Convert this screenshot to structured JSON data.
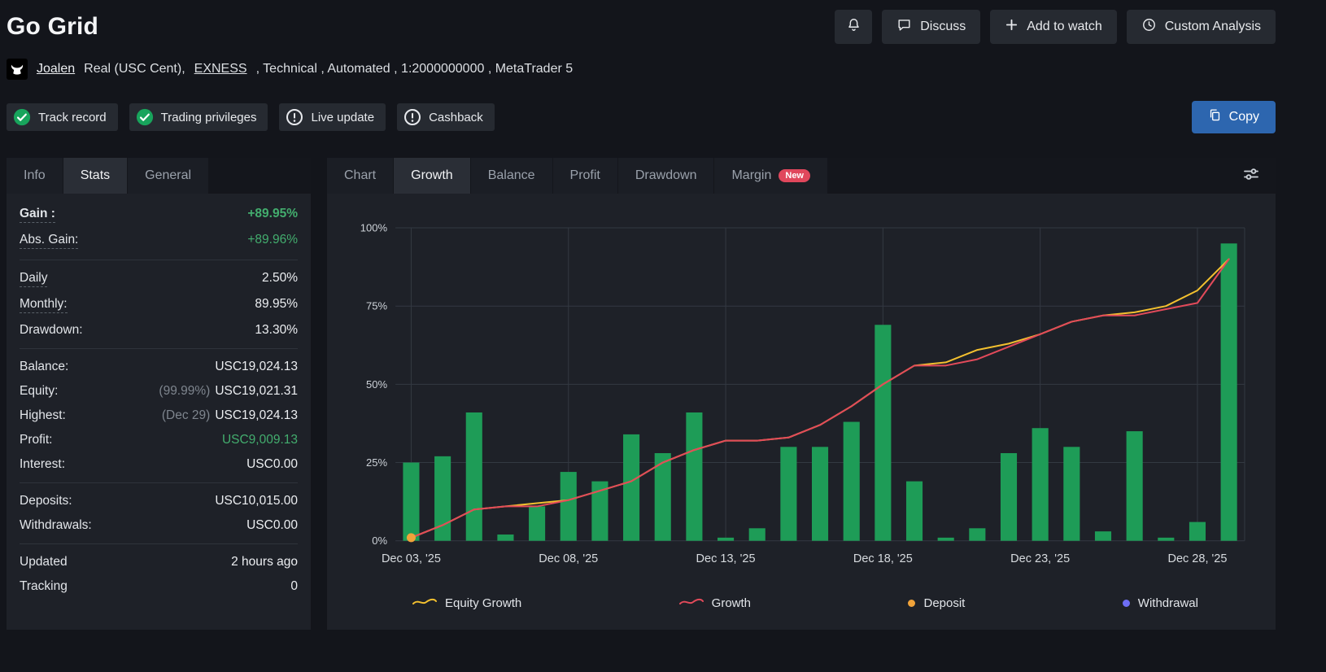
{
  "header": {
    "title": "Go Grid",
    "actions": {
      "discuss": "Discuss",
      "add_to_watch": "Add to watch",
      "custom_analysis": "Custom Analysis"
    }
  },
  "account": {
    "name": "Joalen",
    "type": "Real (USC Cent),",
    "broker": "EXNESS",
    "details": ", Technical , Automated , 1:2000000000 , MetaTrader 5"
  },
  "badges": [
    {
      "label": "Track record",
      "status": "verified"
    },
    {
      "label": "Trading privileges",
      "status": "verified"
    },
    {
      "label": "Live update",
      "status": "warning"
    },
    {
      "label": "Cashback",
      "status": "warning"
    }
  ],
  "copy_button": "Copy",
  "stats_panel": {
    "tabs": [
      {
        "label": "Info",
        "active": false
      },
      {
        "label": "Stats",
        "active": true
      },
      {
        "label": "General",
        "active": false
      }
    ],
    "groups": [
      {
        "rows": [
          {
            "label": "Gain :",
            "value": "+89.95%",
            "value_color": "green",
            "bold": true,
            "underline": true
          },
          {
            "label": "Abs. Gain:",
            "value": "+89.96%",
            "value_color": "green",
            "underline": true
          }
        ]
      },
      {
        "rows": [
          {
            "label": "Daily",
            "value": "2.50%",
            "underline": true
          },
          {
            "label": "Monthly:",
            "value": "89.95%",
            "underline": true
          },
          {
            "label": "Drawdown:",
            "value": "13.30%"
          }
        ]
      },
      {
        "rows": [
          {
            "label": "Balance:",
            "value": "USC19,024.13"
          },
          {
            "label": "Equity:",
            "prefix": "(99.99%)",
            "value": "USC19,021.31"
          },
          {
            "label": "Highest:",
            "prefix": "(Dec 29)",
            "value": "USC19,024.13"
          },
          {
            "label": "Profit:",
            "value": "USC9,009.13",
            "value_color": "green"
          },
          {
            "label": "Interest:",
            "value": "USC0.00"
          }
        ]
      },
      {
        "rows": [
          {
            "label": "Deposits:",
            "value": "USC10,015.00"
          },
          {
            "label": "Withdrawals:",
            "value": "USC0.00"
          }
        ]
      },
      {
        "rows": [
          {
            "label": "Updated",
            "value": "2 hours ago"
          },
          {
            "label": "Tracking",
            "value": "0"
          }
        ]
      }
    ]
  },
  "chart_panel": {
    "tabs": [
      {
        "label": "Chart",
        "active": false
      },
      {
        "label": "Growth",
        "active": true
      },
      {
        "label": "Balance",
        "active": false
      },
      {
        "label": "Profit",
        "active": false
      },
      {
        "label": "Drawdown",
        "active": false
      },
      {
        "label": "Margin",
        "active": false,
        "badge": "New"
      }
    ]
  },
  "chart_data": {
    "type": "bar+line",
    "title": "Growth",
    "categories": [
      "Dec 03",
      "Dec 04",
      "Dec 05",
      "Dec 06",
      "Dec 07",
      "Dec 08",
      "Dec 09",
      "Dec 10",
      "Dec 11",
      "Dec 12",
      "Dec 13",
      "Dec 14",
      "Dec 15",
      "Dec 16",
      "Dec 17",
      "Dec 18",
      "Dec 19",
      "Dec 20",
      "Dec 21",
      "Dec 22",
      "Dec 23",
      "Dec 24",
      "Dec 25",
      "Dec 26",
      "Dec 27",
      "Dec 28",
      "Dec 29"
    ],
    "bar_series": {
      "name": "Daily Gain",
      "color": "#1e9c57",
      "values": [
        25,
        27,
        41,
        2,
        11,
        22,
        19,
        34,
        28,
        41,
        1,
        4,
        30,
        30,
        38,
        69,
        19,
        1,
        4,
        28,
        36,
        30,
        3,
        35,
        1,
        6,
        95
      ]
    },
    "line_series": [
      {
        "name": "Equity Growth",
        "color": "#f3c02f",
        "values": [
          1,
          5,
          10,
          11,
          12,
          13,
          16,
          19,
          25,
          29,
          32,
          32,
          33,
          37,
          43,
          50,
          56,
          57,
          61,
          63,
          66,
          70,
          72,
          73,
          75,
          80,
          90
        ]
      },
      {
        "name": "Growth",
        "color": "#e24a5a",
        "values": [
          1,
          5,
          10,
          11,
          11,
          13,
          16,
          19,
          25,
          29,
          32,
          32,
          33,
          37,
          43,
          50,
          56,
          56,
          58,
          62,
          66,
          70,
          72,
          72,
          74,
          76,
          90
        ]
      }
    ],
    "markers": [
      {
        "name": "Deposit",
        "color": "#f0a33a",
        "index": 0,
        "value": 1
      }
    ],
    "legend": [
      {
        "label": "Equity Growth",
        "type": "line",
        "color": "#f3c02f"
      },
      {
        "label": "Growth",
        "type": "line",
        "color": "#e24a5a"
      },
      {
        "label": "Deposit",
        "type": "dot",
        "color": "#f0a33a"
      },
      {
        "label": "Withdrawal",
        "type": "dot",
        "color": "#6e6ef5"
      }
    ],
    "ylim": [
      0,
      100
    ],
    "y_ticks": [
      "0%",
      "25%",
      "50%",
      "75%",
      "100%"
    ],
    "x_tick_indices": [
      0,
      5,
      10,
      15,
      20,
      25
    ],
    "x_tick_labels": [
      "Dec 03, '25",
      "Dec 08, '25",
      "Dec 13, '25",
      "Dec 18, '25",
      "Dec 23, '25",
      "Dec 28, '25"
    ],
    "grid": true,
    "legend_position": "bottom"
  },
  "colors": {
    "accent_blue": "#2d66af",
    "green": "#43ad6e",
    "bar_green": "#1e9c57",
    "red_line": "#e24a5a",
    "yellow_line": "#f3c02f",
    "deposit_orange": "#f0a33a",
    "withdrawal_violet": "#6e6ef5",
    "new_badge_red": "#e0475c"
  }
}
